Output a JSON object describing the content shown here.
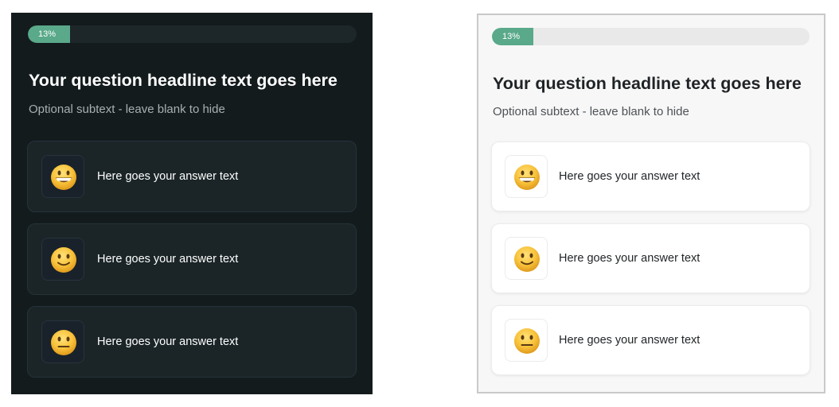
{
  "progress": {
    "percent": 13,
    "label": "13%",
    "fill_color": "#59a98a"
  },
  "question": {
    "headline": "Your question headline text goes here",
    "subtext": "Optional subtext - leave blank to hide"
  },
  "answers": [
    {
      "icon": "grinning-face-icon",
      "text": "Here goes your answer text"
    },
    {
      "icon": "slightly-smiling-face-icon",
      "text": "Here goes your answer text"
    },
    {
      "icon": "neutral-face-icon",
      "text": "Here goes your answer text"
    }
  ],
  "themes": {
    "dark": {
      "background": "#131b1d",
      "text": "#ffffff"
    },
    "light": {
      "background": "#f7f7f7",
      "text": "#1f2326"
    }
  }
}
